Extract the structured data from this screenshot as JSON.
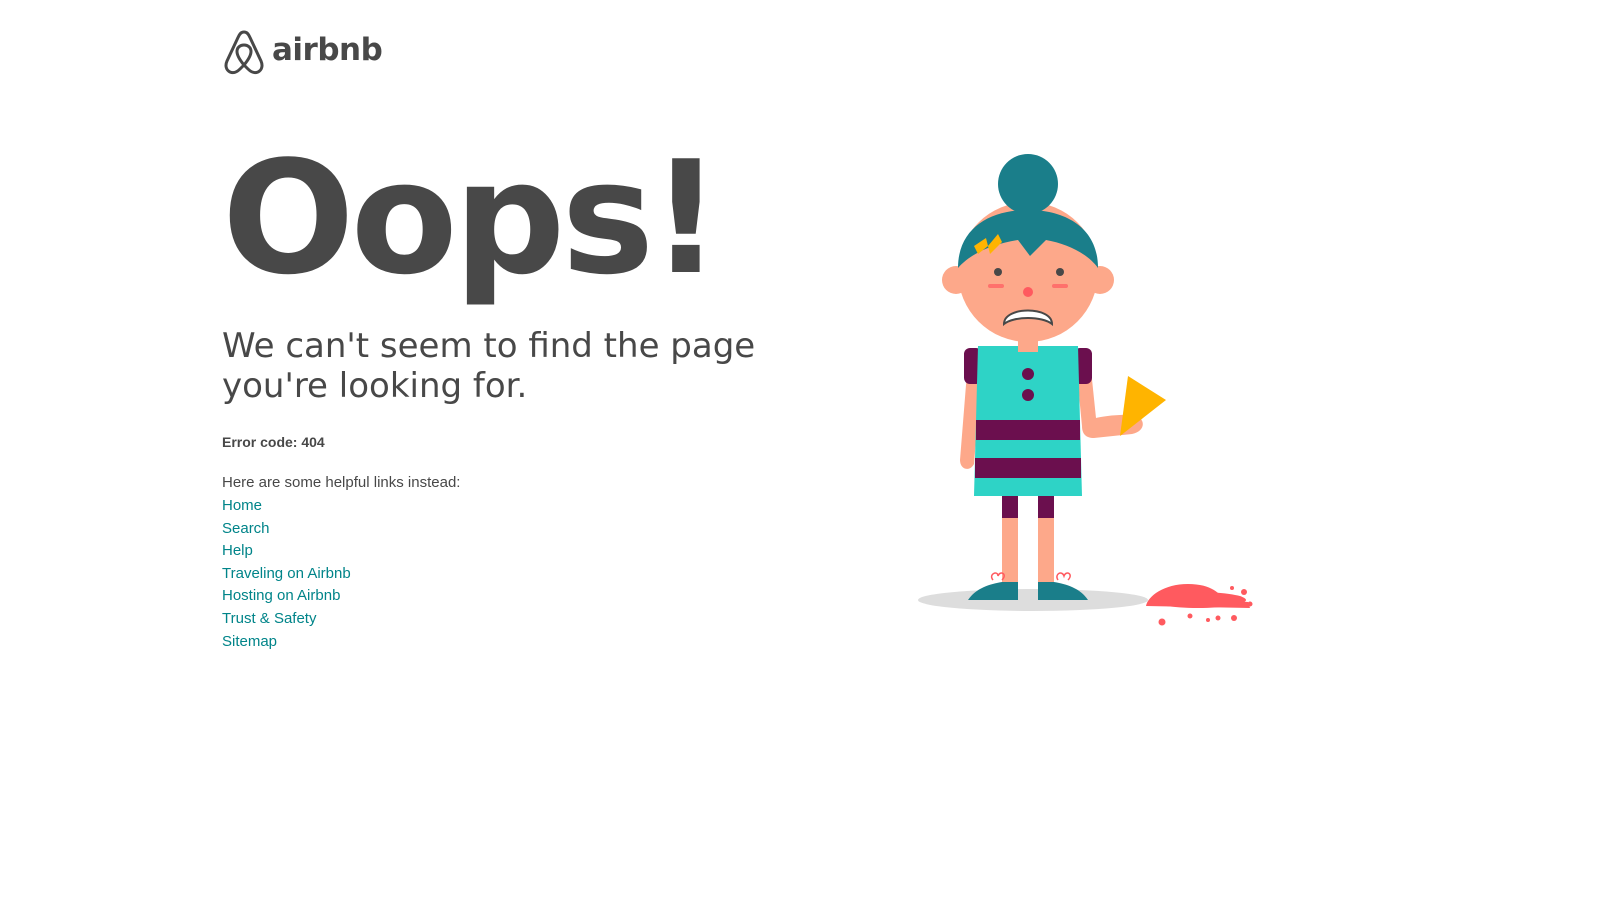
{
  "brand": {
    "name": "airbnb",
    "color": "#FF5A5F",
    "text_color": "#484848"
  },
  "headline": "Oops!",
  "subhead": "We can't seem to find the page you're looking for.",
  "error_code": "Error code: 404",
  "links_intro": "Here are some helpful links instead:",
  "links": [
    {
      "label": "Home"
    },
    {
      "label": "Search"
    },
    {
      "label": "Help"
    },
    {
      "label": "Traveling on Airbnb"
    },
    {
      "label": "Hosting on Airbnb"
    },
    {
      "label": "Trust & Safety"
    },
    {
      "label": "Sitemap"
    }
  ],
  "link_color": "#008489",
  "illustration": {
    "icon": "sad-girl-dropped-ice-cream-illustration",
    "colors": {
      "hair": "#1A7E8A",
      "skin": "#FDA88A",
      "dress": "#2ED3C6",
      "stripes": "#6B0F4E",
      "cone": "#FFB400",
      "ice_cream": "#FF5A5F",
      "shadow": "#DDDDDD"
    }
  }
}
